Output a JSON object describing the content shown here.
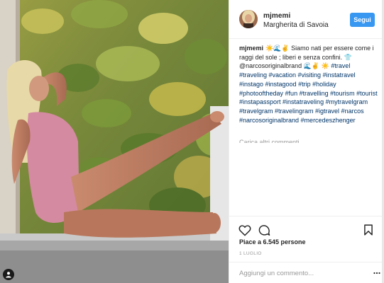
{
  "post": {
    "username": "mjmemi",
    "location": "Margherita di Savoia",
    "follow_label": "Segui",
    "caption_username": "mjmemi",
    "caption_text": "☀️🌊✌️ Siamo nati per essere come i raggi del sole ; liberi e senza confini. 👕 @narcosoriginalbrand 🌊✌️ ☀️ ",
    "caption_hashtags": "#travel #traveling #vacation #visiting #instatravel #instago #instagood #trip #holiday #photooftheday #fun #travelling #tourism #tourist #instapassport #instatraveling #mytravelgram #travelgram #travelingram #igtravel #narcos #narcosoriginalbrand #mercedeszhenger",
    "load_more_label": "Carica altri commenti",
    "likes_text": "Piace a 6.545 persone",
    "date_text": "1 LUGLIO",
    "comment_placeholder": "Aggiungi un commento..."
  },
  "icons": {
    "like": "heart-outline-icon",
    "comment": "comment-bubble-icon",
    "save": "bookmark-icon",
    "more": "more-dots-icon",
    "user_tag": "user-icon"
  },
  "colors": {
    "follow_button": "#3897f0",
    "hashtag": "#003569",
    "muted": "#999999",
    "text": "#262626"
  }
}
